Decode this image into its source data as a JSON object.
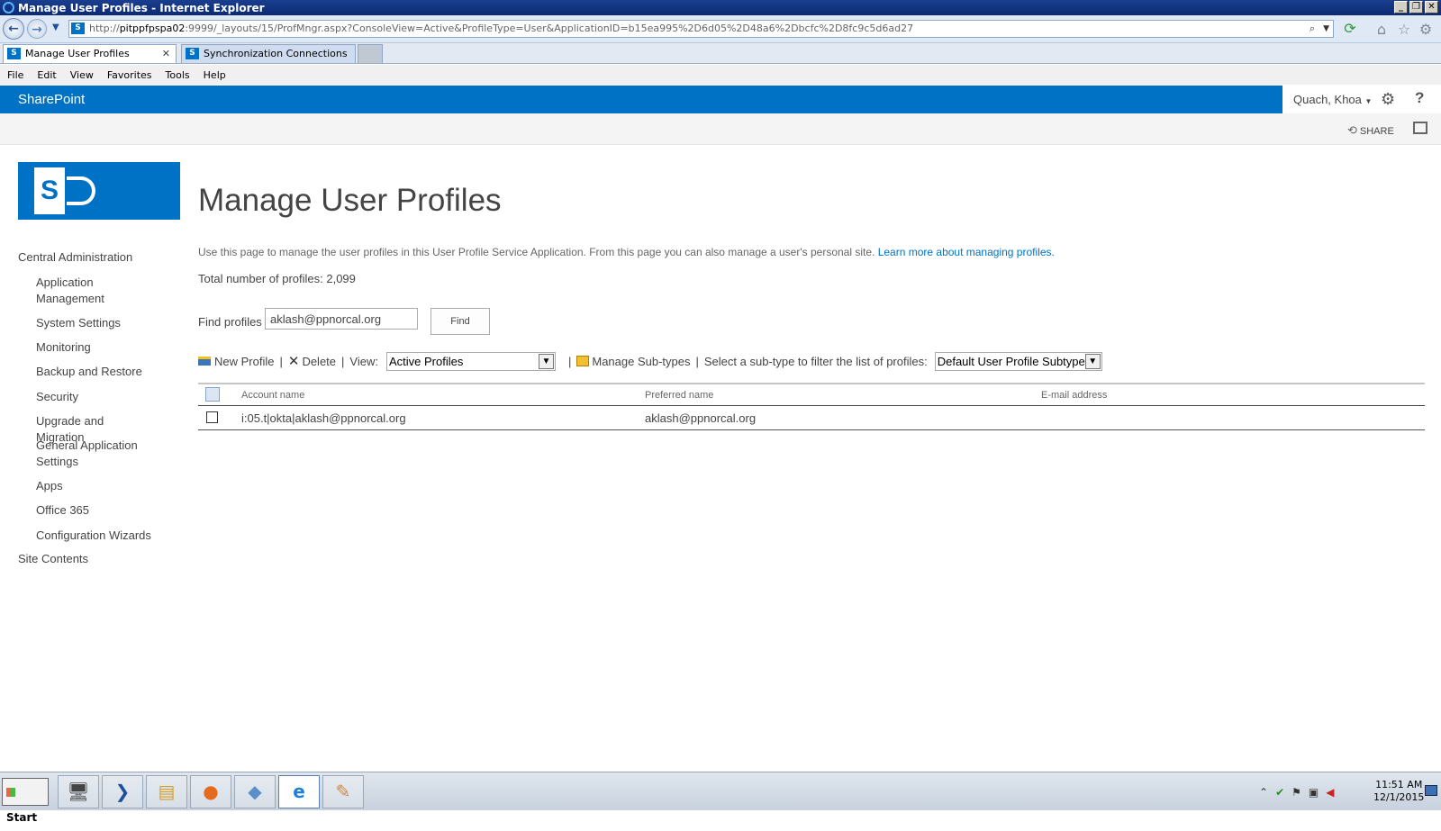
{
  "window": {
    "title": "Manage User Profiles - Internet Explorer",
    "controls": [
      "minimize-icon",
      "restore-icon",
      "close-icon"
    ]
  },
  "addressbar": {
    "url_prefix": "http://",
    "url_host": "pitppfpspa02",
    "url_rest": ":9999/_layouts/15/ProfMngr.aspx?ConsoleView=Active&ProfileType=User&ApplicationID=b15ea995%2D6d05%2D48a6%2Dbcfc%2D8fc9c5d6ad27"
  },
  "tabs": [
    {
      "label": "Manage User Profiles",
      "active": true
    },
    {
      "label": "Synchronization Connections",
      "active": false
    }
  ],
  "menubar": [
    "File",
    "Edit",
    "View",
    "Favorites",
    "Tools",
    "Help"
  ],
  "suitebar": {
    "brand": "SharePoint",
    "user": "Quach, Khoa",
    "help_glyph": "?"
  },
  "ribbon": {
    "share": "SHARE"
  },
  "logo": {
    "letter": "S"
  },
  "page": {
    "title": "Manage User Profiles",
    "description": "Use this page to manage the user profiles in this User Profile Service Application. From this page you can also manage a user's personal site.",
    "learn_more": "Learn more about managing profiles.",
    "total": "Total number of profiles: 2,099"
  },
  "find": {
    "label": "Find profiles",
    "value": "aklash@ppnorcal.org",
    "button": "Find"
  },
  "toolbar": {
    "new_profile": "New Profile",
    "delete": "Delete",
    "view_label": "View:",
    "view_value": "Active Profiles",
    "manage_subtypes": "Manage Sub-types",
    "subtype_label": "Select a sub-type to filter the list of profiles:",
    "subtype_value": "Default User Profile Subtype"
  },
  "table": {
    "columns": [
      "Account name",
      "Preferred name",
      "E-mail address"
    ],
    "rows": [
      {
        "account": "i:05.t|okta|aklash@ppnorcal.org",
        "preferred": "aklash@ppnorcal.org",
        "email": ""
      }
    ]
  },
  "leftnav": {
    "header": "Central Administration",
    "items": [
      "Application Management",
      "System Settings",
      "Monitoring",
      "Backup and Restore",
      "Security",
      "Upgrade and Migration",
      "General Application Settings",
      "Apps",
      "Office 365",
      "Configuration Wizards"
    ],
    "footer": "Site Contents"
  },
  "taskbar": {
    "start": "Start",
    "apps": [
      "server-manager-icon",
      "powershell-icon",
      "explorer-folder-icon",
      "firefox-icon",
      "notes-icon",
      "internet-explorer-icon",
      "paint-icon"
    ],
    "time": "11:51 AM",
    "date": "12/1/2015"
  }
}
